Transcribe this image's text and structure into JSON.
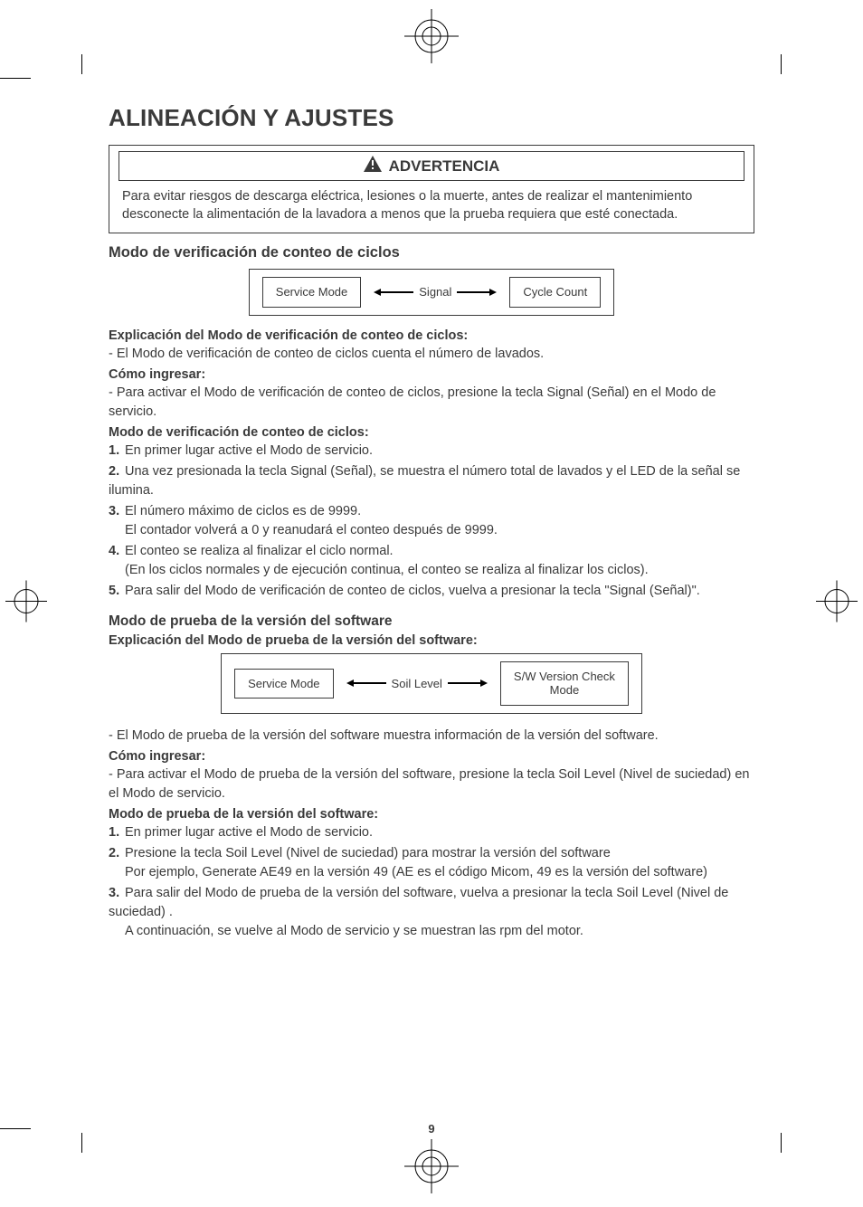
{
  "title": "ALINEACIÓN Y AJUSTES",
  "warning": {
    "label": "ADVERTENCIA",
    "body": "Para evitar riesgos de descarga eléctrica, lesiones o la muerte, antes de realizar el mantenimiento desconecte la alimentación de la lavadora a menos que la prueba requiera que esté conectada."
  },
  "cycle": {
    "heading": "Modo de verificación de conteo de ciclos",
    "diagram": {
      "left": "Service Mode",
      "mid": "Signal",
      "right": "Cycle Count"
    },
    "explain_h": "Explicación del Modo de verificación de conteo de ciclos:",
    "explain_1": "-  El Modo de verificación de conteo de ciclos cuenta el número de lavados.",
    "enter_h": "Cómo ingresar:",
    "enter_1": "-   Para activar el Modo de verificación de conteo de ciclos, presione la tecla Signal (Señal) en el Modo de servicio.",
    "mode_h": "Modo de verificación de conteo de ciclos:",
    "steps": [
      {
        "n": "1.",
        "t": "En primer lugar active el Modo de servicio."
      },
      {
        "n": "2.",
        "t": "Una vez presionada la tecla Signal (Señal), se muestra el número total de lavados y el LED de la señal se ilumina."
      },
      {
        "n": "3.",
        "t": "El número máximo de ciclos es de 9999.",
        "c": "El contador volverá a 0 y reanudará el conteo después de 9999."
      },
      {
        "n": "4.",
        "t": "El conteo se realiza al finalizar el ciclo normal.",
        "c": "(En los ciclos normales y de ejecución continua, el conteo se realiza al finalizar los ciclos)."
      },
      {
        "n": "5.",
        "t": "Para salir del Modo de verificación de conteo de ciclos, vuelva a presionar la tecla \"Signal (Señal)\"."
      }
    ]
  },
  "sw": {
    "heading": "Modo de prueba de la versión del software",
    "explain_h": "Explicación del Modo de prueba de la versión del software:",
    "diagram": {
      "left": "Service Mode",
      "mid": "Soil Level",
      "right": "S/W Version Check\nMode"
    },
    "line1": "-  El Modo de prueba de la versión del software muestra información de la versión del software.",
    "enter_h": "Cómo ingresar:",
    "enter_1": "-   Para activar el Modo de prueba de la versión del software, presione la tecla Soil Level (Nivel de suciedad) en el Modo de servicio.",
    "mode_h": "Modo de prueba de la versión del software:",
    "steps": [
      {
        "n": "1.",
        "t": "En primer lugar active el Modo de servicio."
      },
      {
        "n": "2.",
        "t": "Presione la tecla Soil Level (Nivel de suciedad) para mostrar la versión del software",
        "c": "Por ejemplo, Generate AE49 en la versión 49 (AE es el código Micom, 49 es la versión del software)"
      },
      {
        "n": "3.",
        "t": "Para salir del Modo de prueba de la versión del software, vuelva a presionar la tecla Soil Level (Nivel de suciedad) .",
        "c": "A continuación, se vuelve al Modo de servicio y se muestran las rpm del motor."
      }
    ]
  },
  "page_number": "9",
  "chart_data": [
    {
      "type": "diagram",
      "title": "Cycle Count Check Mode navigation",
      "nodes": [
        "Service Mode",
        "Cycle Count"
      ],
      "edge_label": "Signal",
      "direction": "bidirectional"
    },
    {
      "type": "diagram",
      "title": "S/W Version Check Mode navigation",
      "nodes": [
        "Service Mode",
        "S/W Version Check Mode"
      ],
      "edge_label": "Soil Level",
      "direction": "bidirectional"
    }
  ]
}
